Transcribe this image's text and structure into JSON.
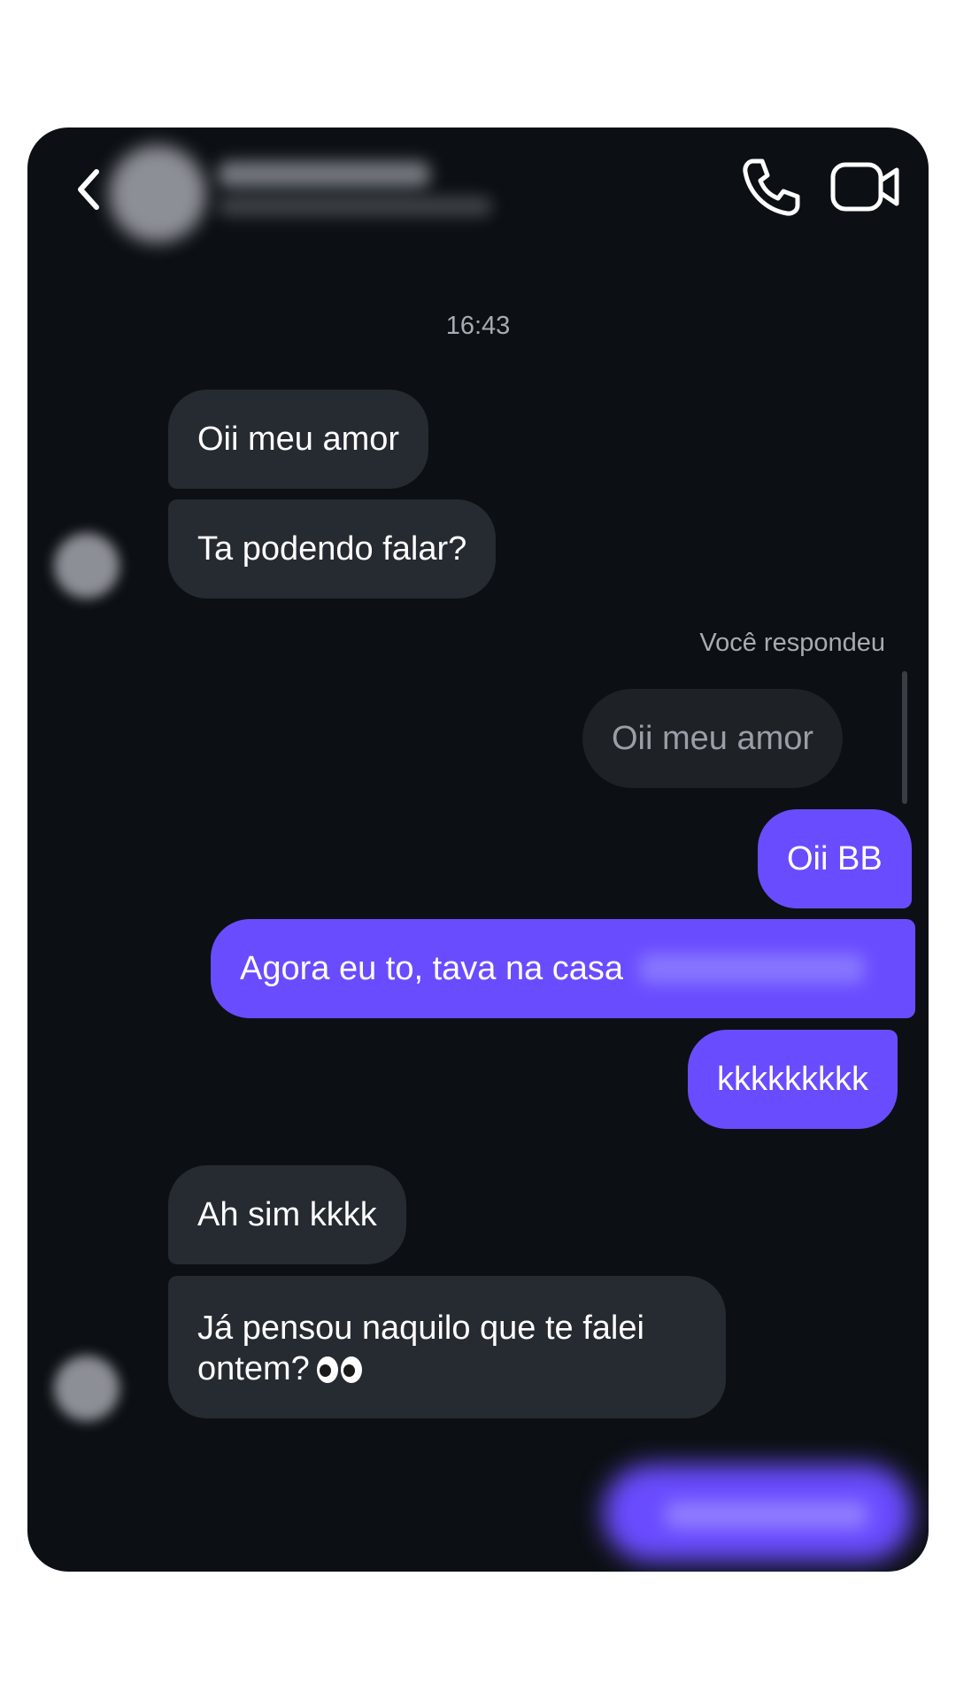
{
  "header": {
    "back": "back-icon",
    "call": "phone-icon",
    "video": "video-camera-icon"
  },
  "thread": {
    "timestamp": "16:43",
    "reply_label": "Você respondeu",
    "messages": [
      {
        "side": "incoming",
        "text": "Oii meu amor"
      },
      {
        "side": "incoming",
        "text": "Ta podendo falar?"
      },
      {
        "side": "quoted",
        "text": "Oii meu amor"
      },
      {
        "side": "outgoing",
        "text": "Oii BB"
      },
      {
        "side": "outgoing",
        "text": "Agora eu to, tava na casa"
      },
      {
        "side": "outgoing",
        "text": "kkkkkkkkk"
      },
      {
        "side": "incoming",
        "text": "Ah sim kkkk"
      },
      {
        "side": "incoming",
        "text": "Já pensou naquilo que te falei ontem?",
        "emoji": "eyes-icon"
      }
    ]
  },
  "colors": {
    "background": "#0c1014",
    "incoming_bubble": "#262a31",
    "outgoing_bubble": "#6a4cff",
    "text": "#ffffff"
  }
}
